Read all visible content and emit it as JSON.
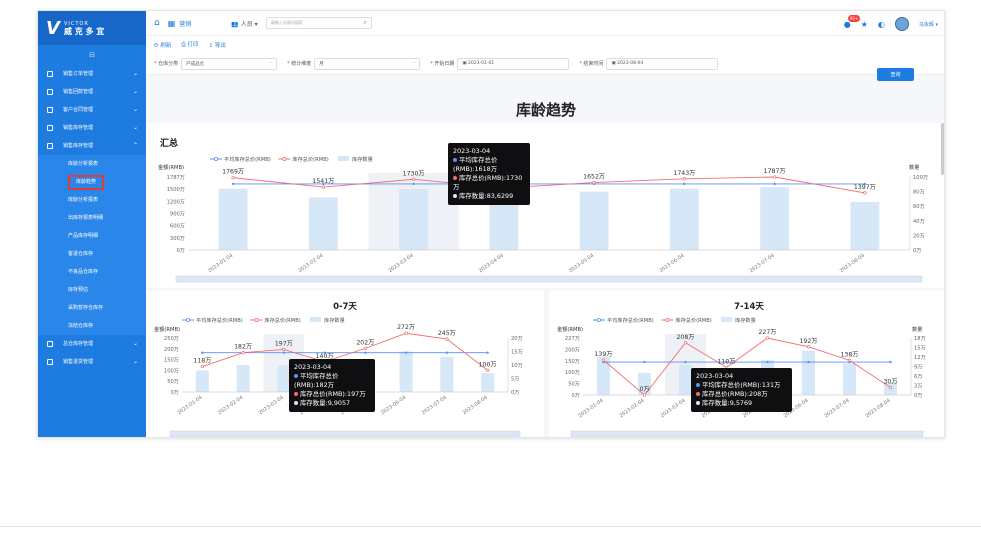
{
  "logo": {
    "brand": "VICTOR",
    "name": "威 克 多 宜"
  },
  "sidebar": {
    "collapse_glyph": "⊟",
    "items": [
      {
        "label": "销售订单管理"
      },
      {
        "label": "销售回款管理"
      },
      {
        "label": "客户合同管理"
      },
      {
        "label": "销售库存管理"
      },
      {
        "label": "销售库存管理",
        "expanded": true
      }
    ],
    "subitems": [
      {
        "label": "库龄分析报表"
      },
      {
        "label": "库龄趋势",
        "active": true
      },
      {
        "label": "库龄分析报表"
      },
      {
        "label": "出库存报表明细"
      },
      {
        "label": "产品库存明细"
      },
      {
        "label": "客退仓库存"
      },
      {
        "label": "不良品仓库存"
      },
      {
        "label": "库存预估"
      },
      {
        "label": "采购暂存仓库存"
      },
      {
        "label": "冻结仓库存"
      }
    ],
    "bottom_items": [
      {
        "label": "总仓库存管理"
      },
      {
        "label": "销售退货管理"
      }
    ]
  },
  "topbar": {
    "app": "营销",
    "person": "人员",
    "search_placeholder": "请输入关键词搜索",
    "badge": "99+",
    "username": "马永辉"
  },
  "toolbar": {
    "refresh": "刷新",
    "print": "打印",
    "export": "导出"
  },
  "filters": {
    "warehouse_label": "仓库分类",
    "warehouse_value": "产成品仓",
    "dimension_label": "统计维度",
    "dimension_value": "月",
    "start_label": "开始日期",
    "start_value": "2023-01-01",
    "end_label": "结束时间",
    "end_value": "2023-08-04",
    "query": "查询"
  },
  "page_title": "库龄趋势",
  "colors": {
    "avg": "#5b8ff9",
    "total": "#f26d6d",
    "bars": "#d6e7f8",
    "accent": "#1e7be0"
  },
  "chart_data": [
    {
      "type": "bar",
      "title": "汇总",
      "ylabel": "金额(RMB)",
      "y2label": "数量",
      "legend": [
        "平均库存总价(RMB)",
        "库存总价(RMB)",
        "库存数量"
      ],
      "legend_position": "top-center",
      "categories": [
        "2023-01-04",
        "2023-02-04",
        "2023-03-04",
        "2023-04-04",
        "2023-05-04",
        "2023-06-04",
        "2023-07-04",
        "2023-08-04"
      ],
      "yticks": [
        "1787万",
        "1500万",
        "1200万",
        "900万",
        "600万",
        "300万",
        "0万"
      ],
      "y2ticks": [
        "100万",
        "80万",
        "60万",
        "40万",
        "20万",
        "0万"
      ],
      "ylim": [
        0,
        1787
      ],
      "y2lim": [
        0,
        100
      ],
      "series": [
        {
          "name": "平均库存总价(RMB)",
          "values": [
            1618,
            1618,
            1618,
            1618,
            1618,
            1618,
            1618,
            1618
          ]
        },
        {
          "name": "库存总价(RMB)",
          "values": [
            1769,
            1541,
            1730,
            1520,
            1652,
            1743,
            1787,
            1397
          ],
          "labels": [
            "1769万",
            "1541万",
            "1730万",
            "",
            "1652万",
            "1743万",
            "1787万",
            "1397万"
          ]
        },
        {
          "name": "库存数量",
          "values": [
            84,
            72,
            83.63,
            75,
            80,
            84,
            86,
            66
          ]
        }
      ],
      "tooltip": {
        "date": "2023-03-04",
        "avg": "平均库存总价(RMB):1618万",
        "total": "库存总价(RMB):1730万",
        "qty": "库存数量:83,6299"
      }
    },
    {
      "type": "bar",
      "title": "0-7天",
      "ylabel": "金额(RMB)",
      "y2label": "",
      "legend": [
        "平均库存总价(RMB)",
        "库存总价(RMB)",
        "库存数量"
      ],
      "legend_position": "top-center",
      "categories": [
        "2023-01-04",
        "2023-02-04",
        "2023-03-04",
        "2023-04-04",
        "2023-05-04",
        "2023-06-04",
        "2023-07-04",
        "2023-08-04"
      ],
      "yticks": [
        "250万",
        "200万",
        "150万",
        "100万",
        "50万",
        "0万"
      ],
      "y2ticks": [
        "20万",
        "15万",
        "10万",
        "5万",
        "0万"
      ],
      "ylim": [
        0,
        250
      ],
      "y2lim": [
        0,
        20
      ],
      "series": [
        {
          "name": "平均库存总价(RMB)",
          "values": [
            182,
            182,
            182,
            182,
            182,
            182,
            182,
            182
          ]
        },
        {
          "name": "库存总价(RMB)",
          "values": [
            118,
            182,
            197,
            140,
            202,
            272,
            245,
            100
          ],
          "labels": [
            "118万",
            "182万",
            "197万",
            "140万",
            "202万",
            "272万",
            "245万",
            "100万"
          ]
        },
        {
          "name": "库存数量",
          "values": [
            8,
            10,
            9.9,
            9,
            11,
            15,
            13,
            7
          ]
        }
      ],
      "tooltip": {
        "date": "2023-03-04",
        "avg": "平均库存总价(RMB):182万",
        "total": "库存总价(RMB):197万",
        "qty": "库存数量:9,9057"
      }
    },
    {
      "type": "bar",
      "title": "7-14天",
      "ylabel": "金额(RMB)",
      "y2label": "数量",
      "legend": [
        "平均库存总价(RMB)",
        "库存总价(RMB)",
        "库存数量"
      ],
      "legend_position": "top-center",
      "categories": [
        "2023-01-04",
        "2023-02-04",
        "2023-03-04",
        "2023-04-04",
        "2023-05-04",
        "2023-06-04",
        "2023-07-04",
        "2023-08-04"
      ],
      "yticks": [
        "227万",
        "200万",
        "150万",
        "100万",
        "50万",
        "0万"
      ],
      "y2ticks": [
        "18万",
        "15万",
        "12万",
        "9万",
        "6万",
        "3万",
        "0万"
      ],
      "ylim": [
        0,
        227
      ],
      "y2lim": [
        0,
        18
      ],
      "series": [
        {
          "name": "平均库存总价(RMB)",
          "values": [
            131,
            131,
            131,
            131,
            131,
            131,
            131,
            131
          ]
        },
        {
          "name": "库存总价(RMB)",
          "values": [
            139,
            0,
            208,
            110,
            227,
            192,
            138,
            30
          ],
          "labels": [
            "139万",
            "0万",
            "208万",
            "110万",
            "227万",
            "192万",
            "138万",
            "30万"
          ]
        },
        {
          "name": "库存数量",
          "values": [
            12,
            7,
            9.58,
            8,
            11,
            14,
            10,
            4
          ]
        }
      ],
      "tooltip": {
        "date": "2023-03-04",
        "avg": "平均库存总价(RMB):131万",
        "total": "库存总价(RMB):208万",
        "qty": "库存数量:9,5769"
      }
    }
  ]
}
